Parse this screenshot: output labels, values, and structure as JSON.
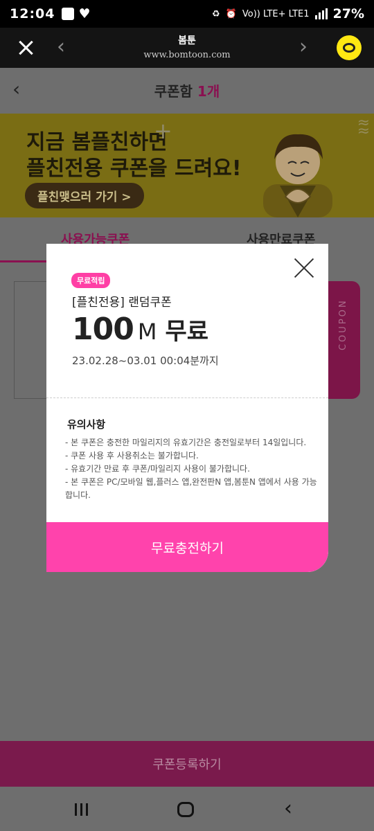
{
  "status_bar": {
    "time": "12:04",
    "network": "Vo)) LTE+ LTE1",
    "battery": "27%"
  },
  "browser": {
    "site_name": "봄툰",
    "url": "www.bomtoon.com"
  },
  "header": {
    "title": "쿠폰함",
    "count": "1개"
  },
  "banner": {
    "line1": "지금 봄플친하면",
    "line2": "플친전용 쿠폰을 드려요!",
    "cta": "플친맺으러 가기 >"
  },
  "tabs": [
    {
      "label": "사용가능쿠폰"
    },
    {
      "label": "사용만료쿠폰"
    }
  ],
  "coupon_tab_label": "COUPON",
  "modal": {
    "badge": "무료적립",
    "title": "[플친전용] 랜덤쿠폰",
    "amount": "100",
    "unit": "M",
    "free_label": "무료",
    "period": "23.02.28~03.01 00:04분까지",
    "notice_title": "유의사항",
    "notices": [
      "- 본 쿠폰은 충전한 마일리지의 유효기간은 충전일로부터 14일입니다.",
      "- 쿠폰 사용 후 사용취소는 불가합니다.",
      "- 유효기간 만료 후 쿠폰/마일리지 사용이 불가합니다.",
      "- 본 쿠폰은 PC/모바일 웹,플러스 앱,완전판N 앱,봄툰N 앱에서 사용 가능합니다."
    ],
    "cta": "무료충전하기"
  },
  "register_button": "쿠폰등록하기",
  "icons": [
    "close-icon",
    "back-arrow-icon",
    "forward-arrow-icon",
    "kakao-talk-icon",
    "modal-close-icon",
    "recent-apps-icon",
    "home-icon",
    "system-back-icon"
  ],
  "colors": {
    "accent_pink": "#ff43ac",
    "badge_pink": "#ff3fa5",
    "overlay": "#6e6e6e"
  }
}
